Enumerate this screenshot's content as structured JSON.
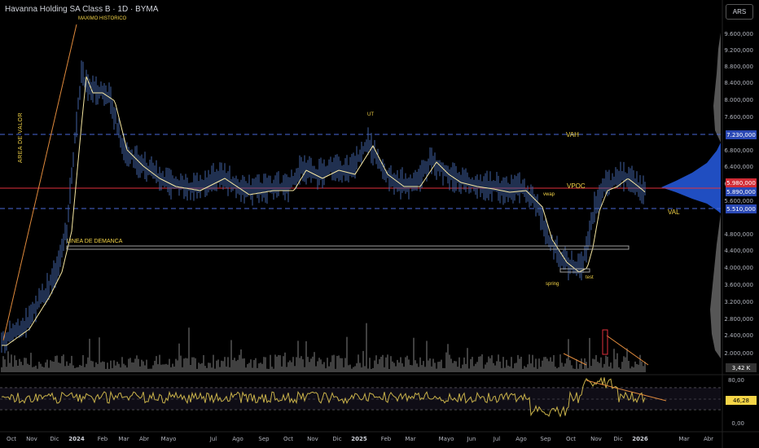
{
  "header": {
    "title": "Havanna Holding SA Class B · 1D · BYMA",
    "currency_button": "ARS"
  },
  "colors": {
    "background": "#000000",
    "candle": "#3f5fa0",
    "ma_line": "#f5e6a0",
    "value_area_line": "#4a67d6",
    "poc_line": "#e0313b",
    "annotation": "#f5d547",
    "profile": "#2457d6",
    "rsi_line": "#c9b24a",
    "trend_line": "#e08a3c"
  },
  "annotations": {
    "maximo": "MAXIMO HISTORICO",
    "ut": "UT",
    "vah": "VAH",
    "vpoc": "VPOC",
    "val": "VAL",
    "vwap": "vwap",
    "linea": "LINEA DE DEMANCA",
    "area": "AREA DE VALOR",
    "spring": "spring",
    "test": "test"
  },
  "price_axis": {
    "labels": [
      "9.600,000",
      "9.200,000",
      "8.800,000",
      "8.400,000",
      "8.000,000",
      "7.600,000",
      "6.800,000",
      "6.400,000",
      "6.000,000",
      "5.600,000",
      "4.800,000",
      "4.400,000",
      "4.000,000",
      "3.600,000",
      "3.200,000",
      "2.800,000",
      "2.400,000",
      "2.000,000"
    ],
    "tags": {
      "vah": "7.230,000",
      "poc": "5.980,000",
      "last": "5.890,000",
      "val": "5.510,000",
      "volume": "3,42 K"
    }
  },
  "rsi_axis": {
    "labels": [
      "80,00",
      "0,00"
    ],
    "value": "46,28"
  },
  "time_axis": {
    "labels": [
      "Oct",
      "Nov",
      "Dic",
      "2024",
      "Feb",
      "Mar",
      "Abr",
      "Mayo",
      "Jul",
      "Ago",
      "Sep",
      "Oct",
      "Nov",
      "Dic",
      "2025",
      "Feb",
      "Mar",
      "Mayo",
      "Jun",
      "Jul",
      "Ago",
      "Sep",
      "Oct",
      "Nov",
      "Dic",
      "2026",
      "Mar",
      "Abr"
    ],
    "bold": [
      "2024",
      "2025",
      "2026"
    ]
  }
}
